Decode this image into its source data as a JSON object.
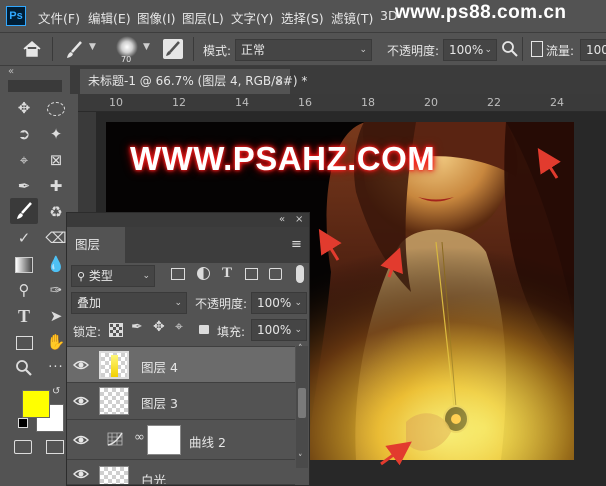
{
  "app": {
    "logo_text": "Ps"
  },
  "menu": [
    "文件(F)",
    "编辑(E)",
    "图像(I)",
    "图层(L)",
    "文字(Y)",
    "选择(S)",
    "滤镜(T)",
    "3D"
  ],
  "watermark": "www.ps88.com.cn",
  "options_bar": {
    "brush_size": "70",
    "mode_label": "模式:",
    "mode_value": "正常",
    "opacity_label": "不透明度:",
    "opacity_value": "100%",
    "flow_label": "流量:",
    "flow_value": "100"
  },
  "document": {
    "tab_title": "未标题-1 @ 66.7% (图层 4, RGB/8#) *",
    "ruler_ticks": [
      "10",
      "12",
      "14",
      "16",
      "18",
      "20",
      "22",
      "24"
    ],
    "canvas_text": "WWW.PSAHZ.COM"
  },
  "colors": {
    "foreground": "#ffff00",
    "background": "#ffffff",
    "arrow": "#e23b2e"
  },
  "layers_panel": {
    "title": "图层",
    "filter_kind": "类型",
    "blend_mode": "叠加",
    "opacity_label": "不透明度:",
    "opacity_value": "100%",
    "lock_label": "锁定:",
    "fill_label": "填充:",
    "fill_value": "100%",
    "layers": [
      {
        "name": "图层 4",
        "selected": true,
        "type": "pixel-yellow"
      },
      {
        "name": "图层 3",
        "selected": false,
        "type": "pixel"
      },
      {
        "name": "曲线 2",
        "selected": false,
        "type": "curves-adjustment"
      },
      {
        "name": "白光",
        "selected": false,
        "type": "pixel"
      }
    ]
  }
}
